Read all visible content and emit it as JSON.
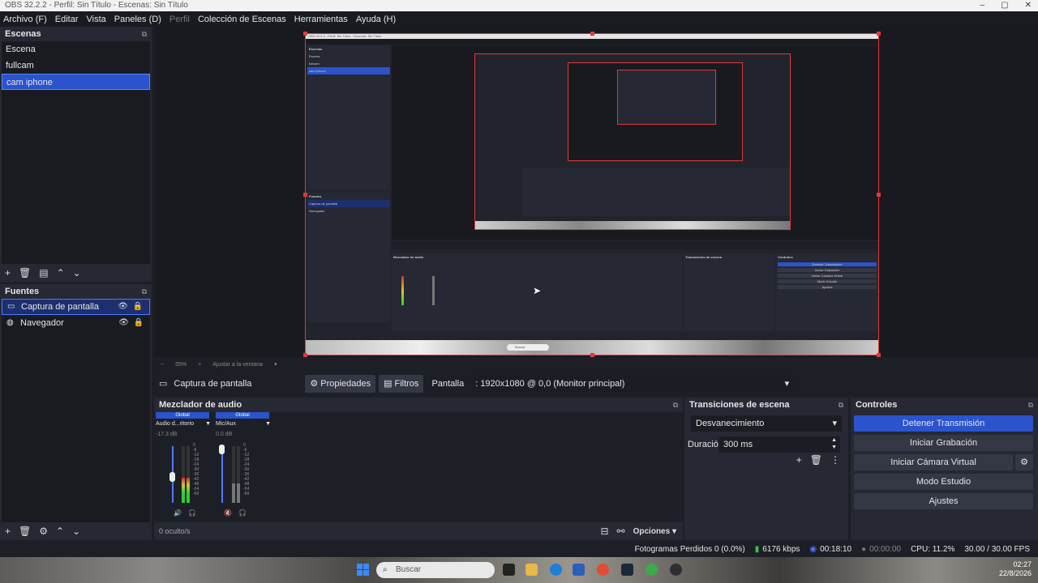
{
  "window": {
    "title": "OBS 32.2.2 - Perfil: Sin Título - Escenas: Sin Título"
  },
  "menu": [
    "Archivo (F)",
    "Editar",
    "Vista",
    "Paneles (D)",
    "Perfil",
    "Colección de Escenas",
    "Herramientas",
    "Ayuda (H)"
  ],
  "scenes": {
    "title": "Escenas",
    "items": [
      "Escena",
      "fullcam",
      "cam iphone"
    ],
    "selected": "cam iphone"
  },
  "sources": {
    "title": "Fuentes",
    "items": [
      "Captura de pantalla",
      "Navegador"
    ]
  },
  "preview": {
    "zoom": "55%",
    "fit_label": "Ajustar a la ventana"
  },
  "source_toolbar": {
    "source_name": "Captura de pantalla",
    "properties": "Propiedades",
    "filters": "Filtros",
    "display_label": "Pantalla",
    "display_value": ": 1920x1080 @ 0,0 (Monitor principal)"
  },
  "mixer": {
    "title": "Mezclador de audio",
    "channels": [
      {
        "head": "Global",
        "name": "Audio d...ritorio",
        "db": "-17.3 dB",
        "level": 0.45
      },
      {
        "head": "Global",
        "name": "Mic/Aux",
        "db": "0.0 dB",
        "level": 0.35
      }
    ],
    "scale": [
      "0",
      "-6",
      "-12",
      "-18",
      "-24",
      "-30",
      "-36",
      "-42",
      "-48",
      "-54",
      "-60"
    ],
    "hidden": "0 oculto/s",
    "options": "Opciones"
  },
  "transitions": {
    "title": "Transiciones de escena",
    "selected": "Desvanecimiento",
    "duration_label": "Duración",
    "duration_value": "300 ms"
  },
  "controls": {
    "title": "Controles",
    "stop_stream": "Detener Transmisión",
    "start_record": "Iniciar Grabación",
    "virtual_cam": "Iniciar Cámara Virtual",
    "studio_mode": "Modo Estudio",
    "settings": "Ajustes"
  },
  "status": {
    "dropped": "Fotogramas Perdidos 0 (0.0%)",
    "bitrate": "6176 kbps",
    "stream_time": "00:18:10",
    "record_time": "00:00:00",
    "cpu": "CPU: 11.2%",
    "fps": "30.00 / 30.00 FPS"
  },
  "taskbar": {
    "search": "Buscar",
    "time": "02:27",
    "date": "22/8/2026"
  },
  "inner_preview": {
    "title": "OBS 32.2.2 - Perfil: Sin Título - Escenas: Sin Título",
    "scenes_title": "Escenas",
    "scenes": [
      "Escena",
      "fullcam",
      "cam iphone"
    ],
    "sources_title": "Fuentes",
    "sources": [
      "Captura de pantalla",
      "Navegador"
    ],
    "mixer_title": "Mezclador de audio",
    "trans_title": "Transiciones de escena",
    "controls_title": "Controles",
    "buttons": [
      "Detener Transmisión",
      "Iniciar Grabación",
      "Iniciar Cámara Virtual",
      "Modo Estudio",
      "Ajustes"
    ],
    "search": "Buscar"
  }
}
